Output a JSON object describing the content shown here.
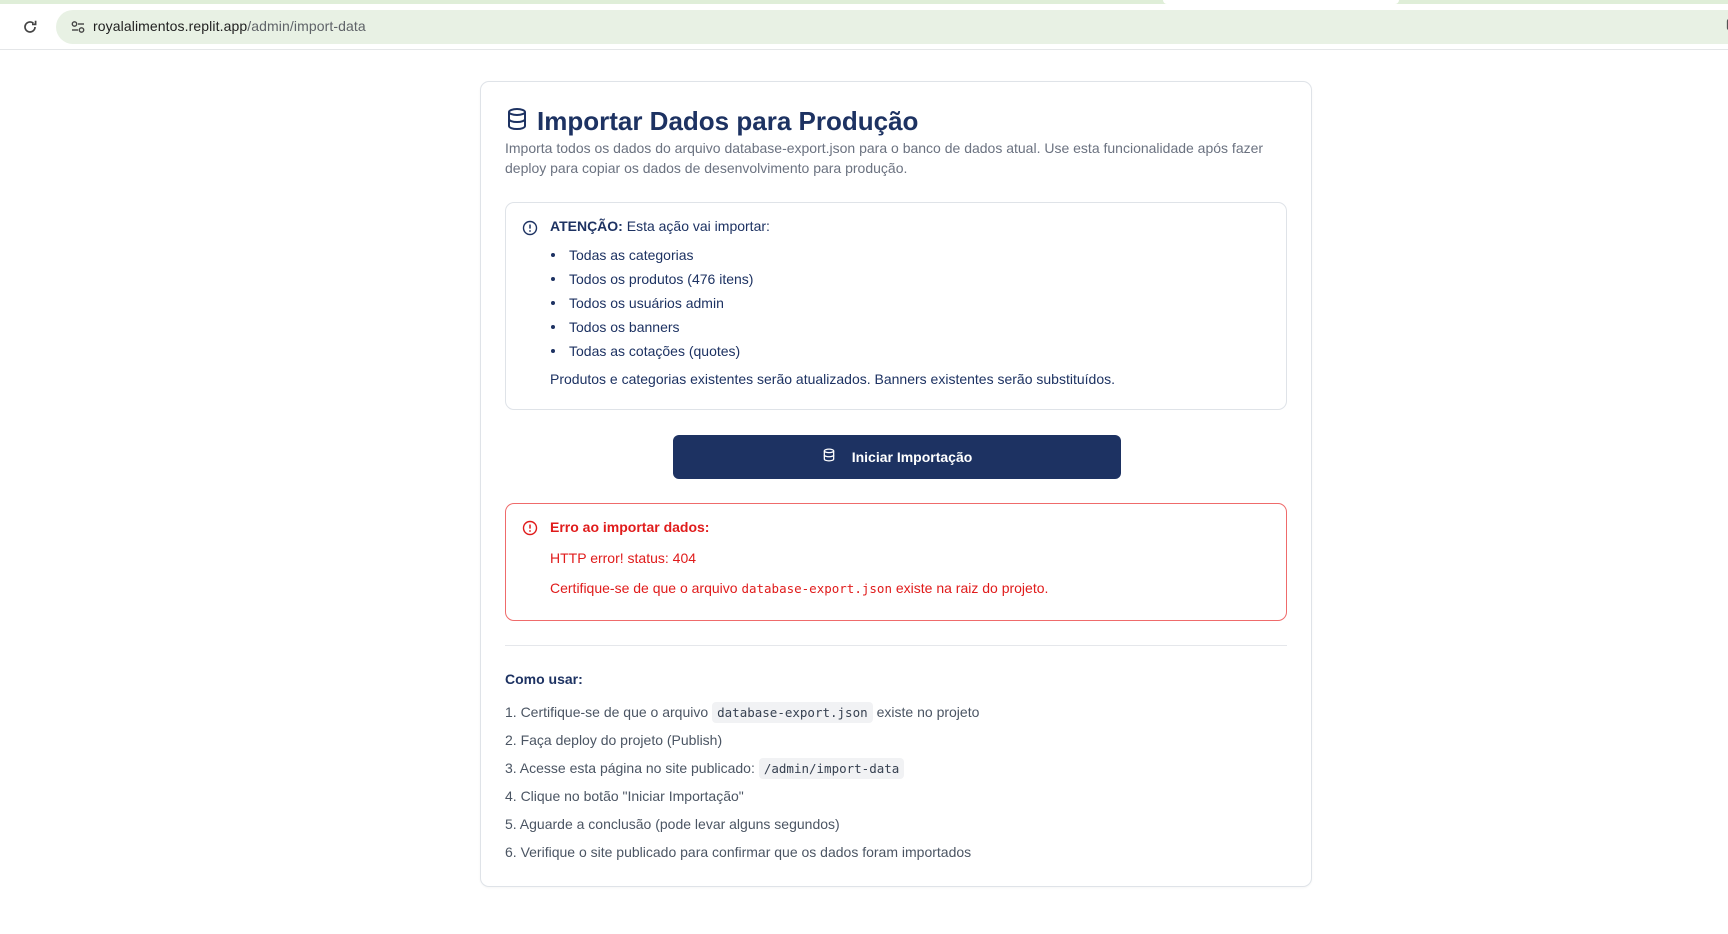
{
  "browser": {
    "url_host": "royalalimentos.replit.app",
    "url_path": "/admin/import-data",
    "icons": [
      "reload-icon",
      "site-settings-icon",
      "translate-icon",
      "star-icon"
    ]
  },
  "card": {
    "title": "Importar Dados para Produção",
    "description": "Importa todos os dados do arquivo database-export.json para o banco de dados atual. Use esta funcionalidade após fazer deploy para copiar os dados de desenvolvimento para produção."
  },
  "alert": {
    "title_bold": "ATENÇÃO:",
    "title_rest": " Esta ação vai importar:",
    "items": [
      "Todas as categorias",
      "Todos os produtos (476 itens)",
      "Todos os usuários admin",
      "Todos os banners",
      "Todas as cotações (quotes)"
    ],
    "footer": "Produtos e categorias existentes serão atualizados. Banners existentes serão substituídos."
  },
  "button": {
    "label": "Iniciar Importação"
  },
  "error": {
    "title": "Erro ao importar dados:",
    "message": "HTTP error! status: 404",
    "hint_before": "Certifique-se de que o arquivo ",
    "hint_code": "database-export.json",
    "hint_after": " existe na raiz do projeto."
  },
  "howto": {
    "title": "Como usar:",
    "steps": [
      {
        "before": "1. Certifique-se de que o arquivo",
        "code": "database-export.json",
        "after": "existe no projeto"
      },
      {
        "before": "2. Faça deploy do projeto (Publish)",
        "code": "",
        "after": ""
      },
      {
        "before": "3. Acesse esta página no site publicado:",
        "code": "/admin/import-data",
        "after": ""
      },
      {
        "before": "4. Clique no botão \"Iniciar Importação\"",
        "code": "",
        "after": ""
      },
      {
        "before": "5. Aguarde a conclusão (pode levar alguns segundos)",
        "code": "",
        "after": ""
      },
      {
        "before": "6. Verifique o site publicado para confirmar que os dados foram importados",
        "code": "",
        "after": ""
      }
    ]
  },
  "colors": {
    "primary": "#1d3262",
    "error": "#e01b1b",
    "muted_text": "#6b7280",
    "omnibox_bg": "#e8f1e4"
  }
}
